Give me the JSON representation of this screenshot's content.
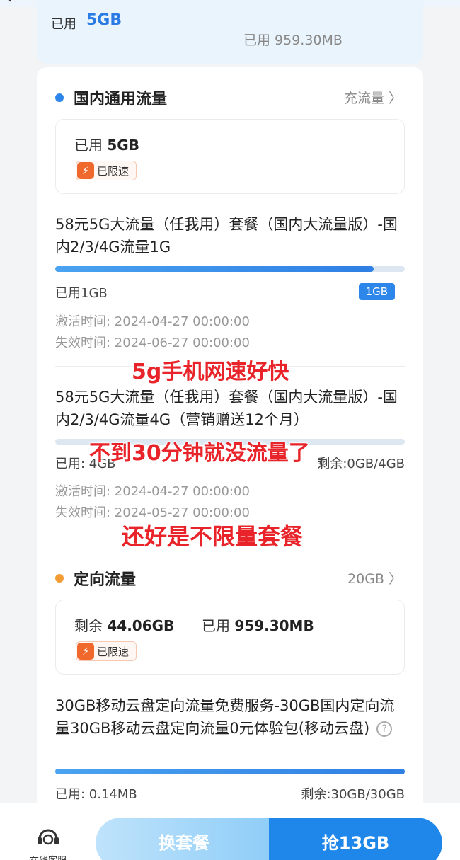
{
  "topbar": {
    "glyph_left": "←",
    "glyph_right": "⋯"
  },
  "summary": {
    "used_label": "已用",
    "used_value": "5GB",
    "right_used": "已用  959.30MB"
  },
  "domestic": {
    "title": "国内通用流量",
    "link": "充流量 〉",
    "used_label": "已用",
    "used_value": "5GB",
    "limit_badge": "已限速",
    "plans": [
      {
        "title": "58元5G大流量（任我用）套餐（国内大流量版）-国内2/3/4G流量1G",
        "progress": 0.91,
        "used": "已用1GB",
        "pill": "1GB",
        "activate": "激活时间: 2024-04-27 00:00:00",
        "expire": "失效时间: 2024-06-27 00:00:00"
      },
      {
        "title": "58元5G大流量（任我用）套餐（国内大流量版）-国内2/3/4G流量4G（营销赠送12个月）",
        "progress": 0.0,
        "used": "已用: 4GB",
        "remaining": "剩余:0GB/4GB",
        "activate": "激活时间: 2024-04-27 00:00:00",
        "expire": "失效时间: 2024-05-27 00:00:00"
      }
    ]
  },
  "directed": {
    "title": "定向流量",
    "link": "20GB 〉",
    "remaining_label": "剩余",
    "remaining_value": "44.06GB",
    "used_label": "已用",
    "used_value": "959.30MB",
    "limit_badge": "已限速",
    "plan": {
      "title": "30GB移动云盘定向流量免费服务-30GB国内定向流量30GB移动云盘定向流量0元体验包(移动云盘)",
      "help": "?",
      "progress": 1.0,
      "used": "已用: 0.14MB",
      "remaining": "剩余:30GB/30GB"
    }
  },
  "overlay": {
    "line1": "5g手机网速好快",
    "line2": "不到30分钟就没流量了",
    "line3": "还好是不限量套餐"
  },
  "bottom": {
    "service_label": "在线客服",
    "change_plan": "换套餐",
    "grab": "抢13GB"
  },
  "colors": {
    "accent": "#2d86ea",
    "dot_blue": "#2d86ea",
    "dot_orange": "#f39c35",
    "overlay_red": "#e8242a",
    "badge_orange": "#f0682c"
  }
}
